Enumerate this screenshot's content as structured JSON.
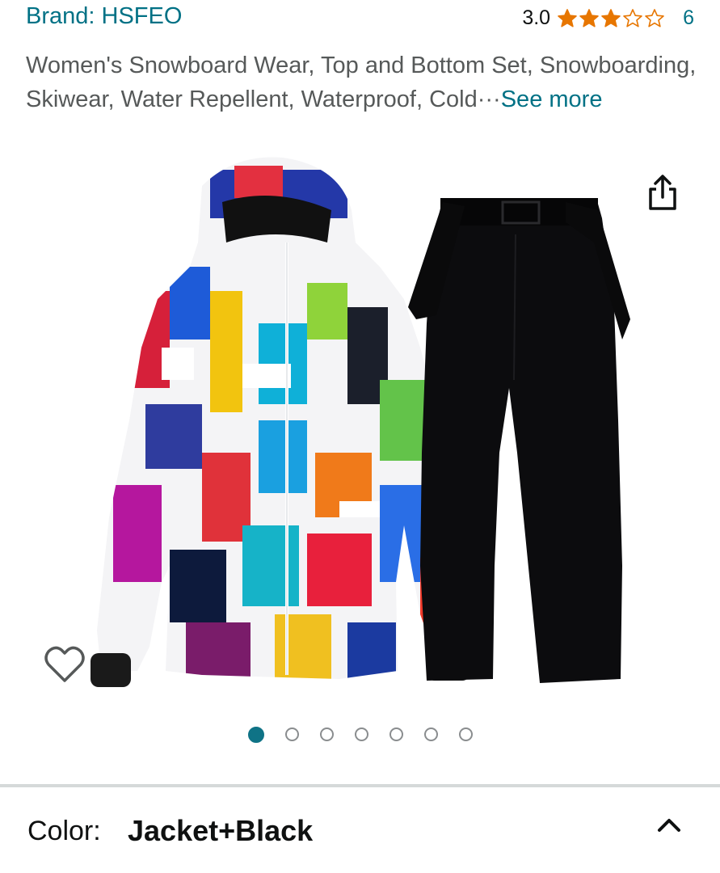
{
  "header": {
    "brand_label": "Brand: HSFEO",
    "rating_value": "3.0",
    "rating_stars": 3,
    "rating_max": 5,
    "rating_count": "6"
  },
  "product": {
    "title": "Women's Snowboard Wear, Top and Bottom Set, Snowboarding, Skiwear, Water Repellent, Waterproof, Cold···",
    "see_more_label": "See more"
  },
  "carousel": {
    "total_images": 7,
    "active_index": 0
  },
  "variation": {
    "label": "Color:",
    "value": "Jacket+Black"
  },
  "icons": {
    "share": "share-icon",
    "wishlist": "heart-icon",
    "chevron": "chevron-up-icon",
    "star": "star-icon"
  },
  "colors": {
    "link": "#007185",
    "star_fill": "#e77600",
    "dot_active": "#0f7386"
  }
}
